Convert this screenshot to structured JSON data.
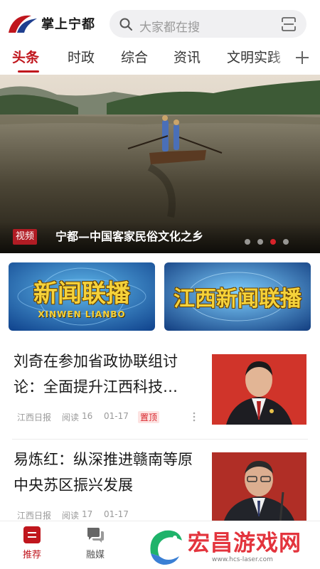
{
  "header": {
    "app_name": "掌上宁都",
    "search_placeholder": "大家都在搜",
    "logo_icon": "app-logo",
    "search_icon": "search-icon",
    "scan_icon": "scan-icon"
  },
  "tabs": [
    {
      "label": "头条",
      "active": true
    },
    {
      "label": "时政",
      "active": false
    },
    {
      "label": "综合",
      "active": false
    },
    {
      "label": "资讯",
      "active": false
    },
    {
      "label": "文明实践",
      "active": false
    }
  ],
  "add_tab_icon": "plus-icon",
  "banner": {
    "badge": "视频",
    "title": "宁都—中国客家民俗文化之乡",
    "slide_count": 4,
    "active_slide": 3
  },
  "programs": [
    {
      "title": "新闻联播",
      "subtitle": "XINWEN LIANBO"
    },
    {
      "title": "江西新闻联播",
      "subtitle": ""
    }
  ],
  "news": [
    {
      "title": "刘奇在参加省政协联组讨论：全面提升江西科技…",
      "source": "江西日报",
      "reads_label": "阅读",
      "reads": "16",
      "date": "01-17",
      "tag": "置顶"
    },
    {
      "title": "易炼红：纵深推进赣南等原中央苏区振兴发展",
      "source": "江西日报",
      "reads_label": "阅读",
      "reads": "17",
      "date": "01-17",
      "tag": ""
    }
  ],
  "bottom_nav": [
    {
      "label": "推荐",
      "icon": "recommend-icon",
      "active": true
    },
    {
      "label": "融媒",
      "icon": "chat-bubbles-icon",
      "active": false
    }
  ],
  "watermark": {
    "text": "宏昌游戏网",
    "url": "www.hcs-laser.com"
  },
  "colors": {
    "accent": "#c0161d",
    "badge": "#b11c24",
    "indicator_active": "#d8232a",
    "watermark": "#e3343d"
  }
}
